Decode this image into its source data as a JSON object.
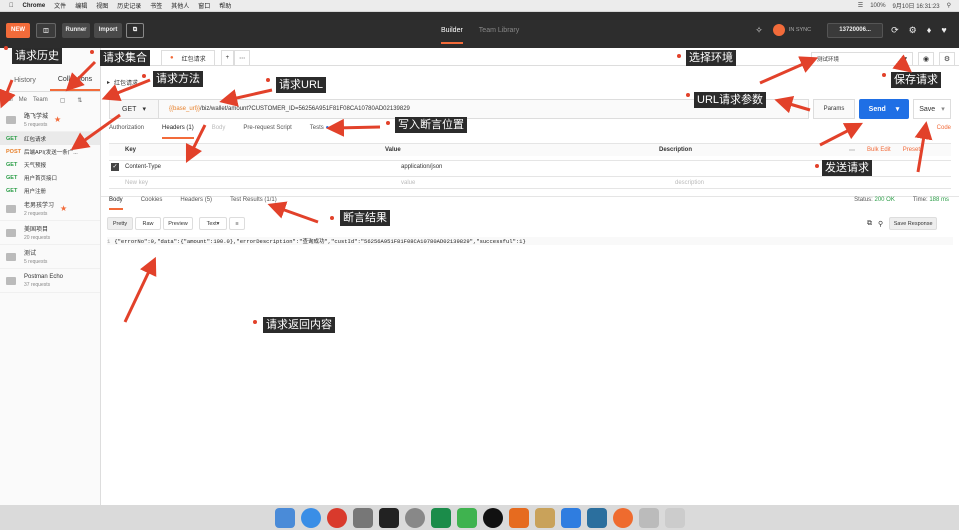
{
  "menubar": {
    "app": "Chrome",
    "items": [
      "文件",
      "编辑",
      "视图",
      "历史记录",
      "书签",
      "其他人",
      "窗口",
      "帮助"
    ],
    "battery": "100%",
    "time": "9月10日 16:31:23"
  },
  "toolbar": {
    "new_label": "NEW",
    "runner_label": "Runner",
    "import_label": "Import",
    "builder_label": "Builder",
    "team_label": "Team Library",
    "sync_label": "IN SYNC",
    "account": "13720006..."
  },
  "sidebar": {
    "tab_history": "History",
    "tab_collections": "Collections",
    "filter_me": "Me",
    "filter_team": "Team",
    "collections": [
      {
        "name": "路飞学城",
        "sub": "5 requests",
        "starred": true
      },
      {
        "name": "老男孩学习",
        "sub": "2 requests",
        "starred": true
      },
      {
        "name": "美国项目",
        "sub": "20 requests",
        "starred": false
      },
      {
        "name": "测试",
        "sub": "5 requests",
        "starred": false
      },
      {
        "name": "Postman Echo",
        "sub": "37 requests",
        "starred": false
      }
    ],
    "requests": [
      {
        "method": "GET",
        "name": "红包请求"
      },
      {
        "method": "POST",
        "name": "后端API(发送一条广..."
      },
      {
        "method": "GET",
        "name": "天气预报"
      },
      {
        "method": "GET",
        "name": "用户首页接口"
      },
      {
        "method": "GET",
        "name": "用户注册"
      }
    ]
  },
  "main": {
    "tab_label": "红包请求",
    "request_title": "红包请求",
    "env": "测试环境",
    "method": "GET",
    "url_var": "{{base_url}}",
    "url_rest": "/biz/wallet/amount?CUSTOMER_ID=56256A951F81F08CA10780AD02139829",
    "params_label": "Params",
    "send_label": "Send",
    "save_label": "Save",
    "subtabs": [
      "Authorization",
      "Headers (1)",
      "Body",
      "Pre-request Script",
      "Tests"
    ],
    "code_label": "Code",
    "kv_headers": {
      "key": "Key",
      "value": "Value",
      "desc": "Description",
      "bulk": "Bulk Edit",
      "presets": "Presets"
    },
    "header_row": {
      "key": "Content-Type",
      "value": "application/json"
    },
    "new_row": {
      "key": "New key",
      "value": "value",
      "desc": "description"
    },
    "resp_tabs": [
      "Body",
      "Cookies",
      "Headers (5)",
      "Test Results (1/1)"
    ],
    "status_label": "Status:",
    "status_value": "200 OK",
    "time_label": "Time:",
    "time_value": "188 ms",
    "view_modes": [
      "Pretty",
      "Raw",
      "Preview"
    ],
    "format": "Text",
    "save_response": "Save Response",
    "line_no": "1",
    "response_body": "{\"errorNo\":0,\"data\":{\"amount\":100.0},\"errorDescription\":\"查询成功\",\"custId\":\"56256A951F81F08CA10780AD02139829\",\"successful\":1}"
  },
  "annotations": {
    "history": "请求历史",
    "collection": "请求集合",
    "method": "请求方法",
    "url": "请求URL",
    "env": "选择环境",
    "save": "保存请求",
    "params": "URL请求参数",
    "assert_pos": "写入断言位置",
    "send": "发送请求",
    "assert_result": "断言结果",
    "response": "请求返回内容"
  }
}
